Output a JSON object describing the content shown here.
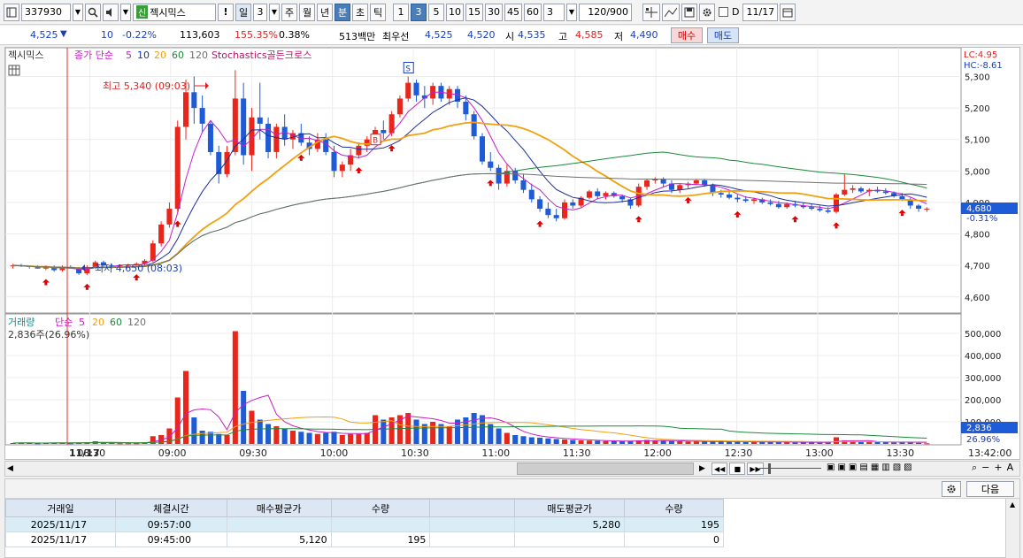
{
  "toolbar": {
    "code": "337930",
    "badge": "신",
    "stock_name": "젝시믹스",
    "warn": "!",
    "period_day": "일",
    "period_num": "3",
    "periods": [
      "주",
      "월",
      "년"
    ],
    "intervals": [
      "분",
      "초",
      "틱"
    ],
    "minutes": [
      "1",
      "3",
      "5",
      "10",
      "15",
      "30",
      "45",
      "60"
    ],
    "active_minute": "3",
    "custom_minute": "3",
    "count": "120",
    "count_total": "/900",
    "date_label": "D",
    "date": "11/17"
  },
  "quote": {
    "price": "4,525",
    "arrow": "▼",
    "change": "10",
    "change_pct": "-0.22%",
    "volume": "113,603",
    "volume_pct": "155.35%",
    "turnover_pct": "0.38%",
    "amount": "513백만",
    "best_label": "최우선",
    "ask": "4,525",
    "bid": "4,520",
    "open_label": "시",
    "open": "4,535",
    "high_label": "고",
    "high": "4,585",
    "low_label": "저",
    "low": "4,490",
    "buy": "매수",
    "sell": "매도"
  },
  "price_panel": {
    "title": "젝시믹스",
    "ma_label": "종가 단순",
    "ma_periods": [
      "5",
      "10",
      "20",
      "60",
      "120"
    ],
    "indicator": "Stochastics골든크로스",
    "lc": "LC:4.95",
    "hc": "HC:-8.61",
    "high_annot": "최고 5,340 (09:03)",
    "low_annot": "최저 4,650 (08:03)",
    "last_price": "4,680",
    "last_pct": "-0.31%",
    "signal_s": "S",
    "signal_b": "B",
    "y_ticks": [
      "5,300",
      "5,200",
      "5,100",
      "5,000",
      "4,900",
      "4,800",
      "4,700",
      "4,600"
    ]
  },
  "volume_panel": {
    "title": "거래량",
    "ma_label": "단순",
    "ma_periods": [
      "5",
      "20",
      "60",
      "120"
    ],
    "last": "2,836주(26.96%)",
    "last_value": "2,836",
    "last_pct": "26.96%",
    "y_ticks": [
      "500,000",
      "400,000",
      "300,000",
      "200,000",
      "100,000"
    ]
  },
  "x_axis": {
    "date": "11/17",
    "times": [
      "08:30",
      "09:00",
      "09:30",
      "10:00",
      "10:30",
      "11:00",
      "11:30",
      "12:00",
      "12:30",
      "13:00",
      "13:30"
    ],
    "end": "13:42:00"
  },
  "table": {
    "next": "다음",
    "headers": [
      "거래일",
      "체결시간",
      "매수평균가",
      "수량",
      "",
      "매도평균가",
      "수량"
    ],
    "rows": [
      [
        "2025/11/17",
        "09:57:00",
        "",
        "",
        "",
        "5,280",
        "195"
      ],
      [
        "2025/11/17",
        "09:45:00",
        "5,120",
        "195",
        "",
        "",
        "0"
      ]
    ]
  },
  "colors": {
    "up": "#e8261c",
    "down": "#1e5bd6",
    "ma5": "#c81ec8",
    "ma10": "#1c2f9a",
    "ma20": "#f0a010",
    "ma60": "#1a8a3a",
    "ma120": "#707070"
  },
  "chart_data": {
    "type": "candlestick",
    "x_range": [
      "08:00",
      "13:42"
    ],
    "y_range": [
      4560,
      5380
    ],
    "volume_range": [
      0,
      520000
    ],
    "highest": {
      "price": 5340,
      "time": "09:03"
    },
    "lowest": {
      "price": 4650,
      "time": "08:03"
    },
    "last_price": 4680,
    "bars": [
      [
        4700,
        4705,
        4690,
        4700,
        4000
      ],
      [
        4700,
        4705,
        4695,
        4698,
        5000
      ],
      [
        4698,
        4700,
        4690,
        4695,
        4000
      ],
      [
        4695,
        4700,
        4690,
        4690,
        3000
      ],
      [
        4690,
        4700,
        4685,
        4695,
        4000
      ],
      [
        4695,
        4700,
        4680,
        4685,
        6000
      ],
      [
        4685,
        4700,
        4680,
        4695,
        5000
      ],
      [
        4695,
        4700,
        4690,
        4690,
        3000
      ],
      [
        4690,
        4695,
        4670,
        4675,
        6000
      ],
      [
        4675,
        4700,
        4670,
        4695,
        8000
      ],
      [
        4695,
        4715,
        4690,
        4710,
        12000
      ],
      [
        4710,
        4715,
        4695,
        4700,
        6000
      ],
      [
        4700,
        4705,
        4690,
        4698,
        4000
      ],
      [
        4698,
        4702,
        4695,
        4700,
        3000
      ],
      [
        4700,
        4705,
        4695,
        4702,
        3000
      ],
      [
        4702,
        4710,
        4700,
        4705,
        3000
      ],
      [
        4705,
        4720,
        4700,
        4715,
        8000
      ],
      [
        4715,
        4780,
        4710,
        4770,
        35000
      ],
      [
        4770,
        4840,
        4760,
        4830,
        40000
      ],
      [
        4830,
        4900,
        4820,
        4880,
        70000
      ],
      [
        4880,
        5160,
        4870,
        5140,
        210000
      ],
      [
        5140,
        5290,
        5100,
        5250,
        330000
      ],
      [
        5250,
        5300,
        5150,
        5200,
        120000
      ],
      [
        5200,
        5240,
        5120,
        5150,
        60000
      ],
      [
        5150,
        5160,
        5050,
        5060,
        55000
      ],
      [
        5060,
        5080,
        4960,
        4990,
        45000
      ],
      [
        4990,
        5080,
        4980,
        5060,
        40000
      ],
      [
        5060,
        5320,
        5050,
        5230,
        510000
      ],
      [
        5230,
        5280,
        5020,
        5050,
        240000
      ],
      [
        5050,
        5200,
        5000,
        5170,
        150000
      ],
      [
        5170,
        5280,
        5100,
        5150,
        110000
      ],
      [
        5150,
        5170,
        5040,
        5060,
        90000
      ],
      [
        5060,
        5150,
        5040,
        5140,
        80000
      ],
      [
        5140,
        5180,
        5080,
        5100,
        70000
      ],
      [
        5100,
        5130,
        5070,
        5120,
        60000
      ],
      [
        5120,
        5150,
        5080,
        5090,
        55000
      ],
      [
        5090,
        5110,
        5050,
        5070,
        50000
      ],
      [
        5070,
        5120,
        5060,
        5100,
        45000
      ],
      [
        5100,
        5120,
        5050,
        5060,
        50000
      ],
      [
        5060,
        5080,
        4980,
        5000,
        55000
      ],
      [
        5000,
        5030,
        4980,
        5020,
        40000
      ],
      [
        5020,
        5070,
        5000,
        5050,
        45000
      ],
      [
        5050,
        5090,
        5040,
        5080,
        45000
      ],
      [
        5080,
        5110,
        5060,
        5100,
        50000
      ],
      [
        5100,
        5140,
        5090,
        5130,
        130000
      ],
      [
        5130,
        5160,
        5100,
        5120,
        110000
      ],
      [
        5120,
        5190,
        5110,
        5180,
        120000
      ],
      [
        5180,
        5240,
        5170,
        5230,
        130000
      ],
      [
        5230,
        5300,
        5220,
        5280,
        140000
      ],
      [
        5280,
        5290,
        5220,
        5240,
        110000
      ],
      [
        5240,
        5270,
        5200,
        5230,
        90000
      ],
      [
        5230,
        5280,
        5210,
        5270,
        100000
      ],
      [
        5270,
        5280,
        5220,
        5230,
        90000
      ],
      [
        5230,
        5270,
        5210,
        5260,
        80000
      ],
      [
        5260,
        5270,
        5200,
        5220,
        110000
      ],
      [
        5220,
        5240,
        5160,
        5180,
        120000
      ],
      [
        5180,
        5190,
        5100,
        5110,
        140000
      ],
      [
        5110,
        5120,
        5020,
        5030,
        130000
      ],
      [
        5030,
        5060,
        5000,
        5010,
        90000
      ],
      [
        5010,
        5020,
        4940,
        4960,
        70000
      ],
      [
        4960,
        5020,
        4950,
        5000,
        50000
      ],
      [
        5000,
        5010,
        4960,
        4970,
        40000
      ],
      [
        4970,
        4990,
        4930,
        4940,
        35000
      ],
      [
        4940,
        4960,
        4900,
        4910,
        30000
      ],
      [
        4910,
        4920,
        4870,
        4880,
        28000
      ],
      [
        4880,
        4900,
        4850,
        4860,
        25000
      ],
      [
        4860,
        4880,
        4840,
        4850,
        22000
      ],
      [
        4850,
        4910,
        4845,
        4900,
        20000
      ],
      [
        4900,
        4910,
        4880,
        4890,
        18000
      ],
      [
        4890,
        4920,
        4885,
        4915,
        16000
      ],
      [
        4915,
        4940,
        4910,
        4935,
        15000
      ],
      [
        4935,
        4945,
        4910,
        4920,
        14000
      ],
      [
        4920,
        4935,
        4910,
        4930,
        13000
      ],
      [
        4930,
        4935,
        4915,
        4920,
        12000
      ],
      [
        4920,
        4925,
        4900,
        4910,
        12000
      ],
      [
        4910,
        4915,
        4880,
        4890,
        14000
      ],
      [
        4890,
        4960,
        4885,
        4950,
        16000
      ],
      [
        4950,
        4975,
        4940,
        4970,
        18000
      ],
      [
        4970,
        4980,
        4960,
        4975,
        15000
      ],
      [
        4975,
        4980,
        4950,
        4960,
        14000
      ],
      [
        4960,
        4970,
        4930,
        4940,
        13000
      ],
      [
        4940,
        4960,
        4930,
        4955,
        12000
      ],
      [
        4955,
        4965,
        4945,
        4960,
        11000
      ],
      [
        4960,
        4975,
        4955,
        4970,
        11000
      ],
      [
        4970,
        4975,
        4950,
        4955,
        10000
      ],
      [
        4955,
        4960,
        4920,
        4930,
        12000
      ],
      [
        4930,
        4940,
        4915,
        4925,
        11000
      ],
      [
        4925,
        4935,
        4910,
        4915,
        10000
      ],
      [
        4915,
        4925,
        4900,
        4910,
        10000
      ],
      [
        4910,
        4920,
        4900,
        4905,
        9000
      ],
      [
        4905,
        4915,
        4895,
        4910,
        9000
      ],
      [
        4910,
        4915,
        4895,
        4900,
        9000
      ],
      [
        4900,
        4910,
        4890,
        4895,
        9000
      ],
      [
        4895,
        4905,
        4880,
        4885,
        8000
      ],
      [
        4885,
        4900,
        4880,
        4895,
        8000
      ],
      [
        4895,
        4905,
        4885,
        4890,
        7000
      ],
      [
        4890,
        4900,
        4880,
        4885,
        7000
      ],
      [
        4885,
        4895,
        4875,
        4880,
        7000
      ],
      [
        4880,
        4890,
        4870,
        4875,
        7000
      ],
      [
        4875,
        4885,
        4865,
        4870,
        8000
      ],
      [
        4870,
        4930,
        4865,
        4925,
        30000
      ],
      [
        4925,
        4990,
        4920,
        4940,
        16000
      ],
      [
        4940,
        4955,
        4930,
        4945,
        10000
      ],
      [
        4945,
        4950,
        4930,
        4935,
        9000
      ],
      [
        4935,
        4945,
        4920,
        4940,
        9000
      ],
      [
        4940,
        4950,
        4930,
        4935,
        8000
      ],
      [
        4935,
        4945,
        4925,
        4930,
        8000
      ],
      [
        4930,
        4935,
        4915,
        4920,
        7000
      ],
      [
        4920,
        4930,
        4905,
        4910,
        9000
      ],
      [
        4910,
        4915,
        4880,
        4890,
        8000
      ],
      [
        4890,
        4895,
        4870,
        4880,
        5000
      ],
      [
        4880,
        4885,
        4870,
        4880,
        2836
      ]
    ]
  }
}
